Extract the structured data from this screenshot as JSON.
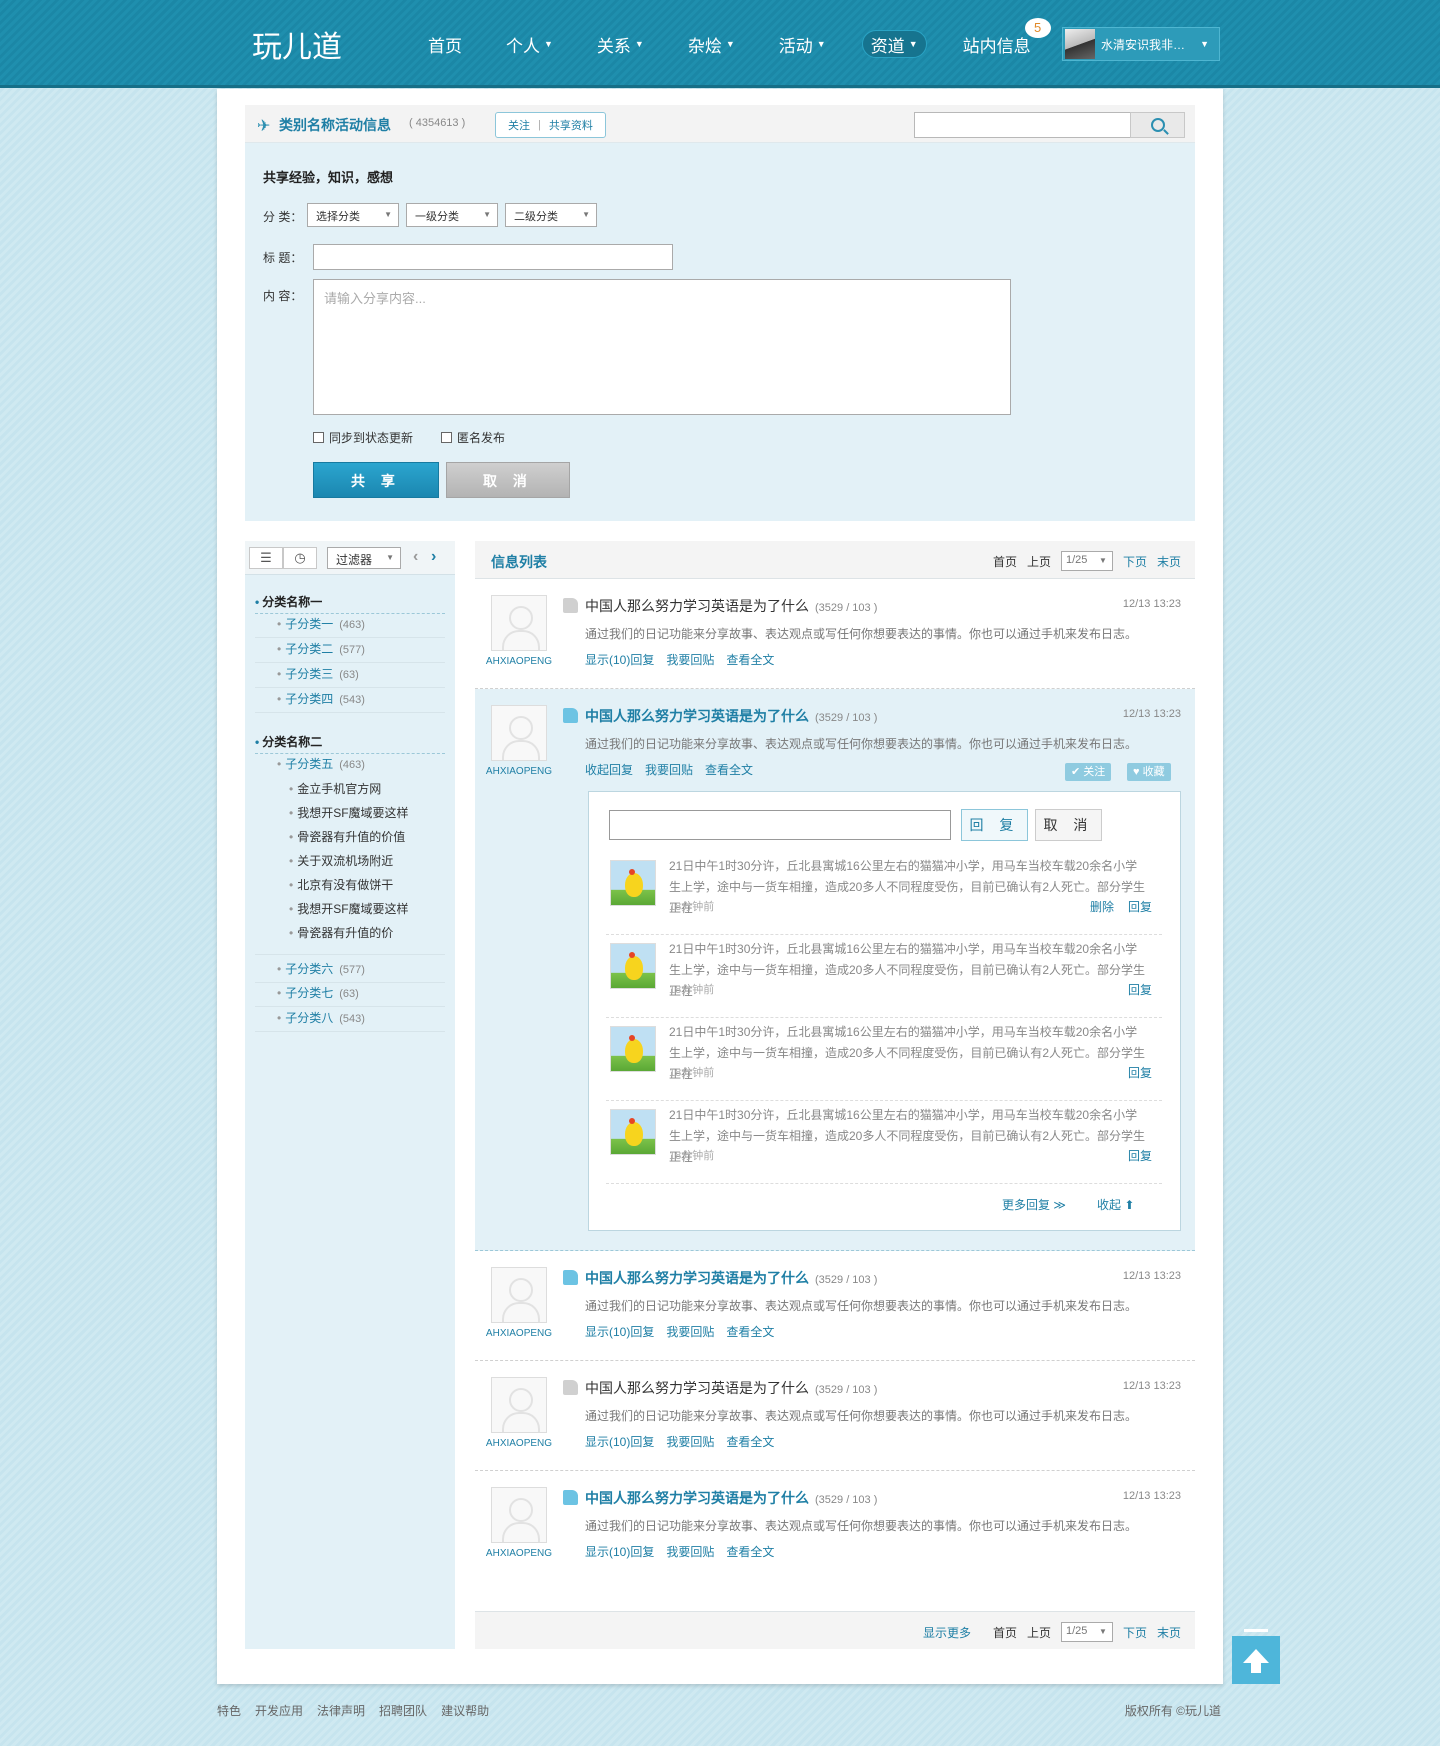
{
  "header": {
    "logo": "玩儿道",
    "nav": [
      {
        "label": "首页",
        "caret": false
      },
      {
        "label": "个人",
        "caret": true
      },
      {
        "label": "关系",
        "caret": true
      },
      {
        "label": "杂烩",
        "caret": true
      },
      {
        "label": "活动",
        "caret": true
      },
      {
        "label": "资道",
        "caret": true,
        "active": true
      },
      {
        "label": "站内信息",
        "caret": false,
        "badge": "5"
      }
    ],
    "user_name": "水清安识我非…"
  },
  "share": {
    "title": "类别名称活动信息",
    "count": "( 4354613 )",
    "tab_follow": "关注",
    "tab_profile": "共享资料",
    "search_placeholder": "",
    "subtitle": "共享经验，知识，感想",
    "label_category": "分 类：",
    "label_title": "标 题：",
    "label_content": "内 容：",
    "select_category": "选择分类",
    "select_level1": "一级分类",
    "select_level2": "二级分类",
    "content_placeholder": "请输入分享内容...",
    "sync_label": "同步到状态更新",
    "anon_label": "匿名发布",
    "share_btn": "共 享",
    "cancel_btn": "取 消"
  },
  "sidebar": {
    "filter_label": "过滤器",
    "cat1": "分类名称一",
    "cat2": "分类名称二",
    "subs": [
      {
        "name": "子分类一",
        "count": "(463)"
      },
      {
        "name": "子分类二",
        "count": "(577)"
      },
      {
        "name": "子分类三",
        "count": "(63)"
      },
      {
        "name": "子分类四",
        "count": "(543)"
      },
      {
        "name": "子分类五",
        "count": "(463)"
      },
      {
        "name": "子分类六",
        "count": "(577)"
      },
      {
        "name": "子分类七",
        "count": "(63)"
      },
      {
        "name": "子分类八",
        "count": "(543)"
      }
    ],
    "leaves": [
      "金立手机官方网",
      "我想开SF魔域要这样",
      "骨瓷器有升值的价值",
      "关于双流机场附近",
      "北京有没有做饼干",
      "我想开SF魔域要这样",
      "骨瓷器有升值的价"
    ]
  },
  "list": {
    "title": "信息列表",
    "first": "首页",
    "prev": "上页",
    "page": "1/25",
    "next": "下页",
    "last": "末页",
    "show_more": "显示更多"
  },
  "posts": [
    {
      "user": "AHXIAOPENG",
      "title": "中国人那么努力学习英语是为了什么",
      "count": "(3529 / 103 )",
      "time": "12/13 13:23",
      "desc": "通过我们的日记功能来分享故事、表达观点或写任何你想要表达的事情。你也可以通过手机来发布日志。",
      "a1": "显示(10)回复",
      "a2": "我要回贴",
      "a3": "查看全文"
    },
    {
      "user": "AHXIAOPENG",
      "title": "中国人那么努力学习英语是为了什么",
      "count": "(3529 / 103 )",
      "time": "12/13 13:23",
      "desc": "通过我们的日记功能来分享故事、表达观点或写任何你想要表达的事情。你也可以通过手机来发布日志。",
      "a1": "收起回复",
      "a2": "我要回贴",
      "a3": "查看全文",
      "follow": "关注",
      "collect": "收藏"
    },
    {
      "user": "AHXIAOPENG",
      "title": "中国人那么努力学习英语是为了什么",
      "count": "(3529 / 103 )",
      "time": "12/13 13:23",
      "desc": "通过我们的日记功能来分享故事、表达观点或写任何你想要表达的事情。你也可以通过手机来发布日志。",
      "a1": "显示(10)回复",
      "a2": "我要回贴",
      "a3": "查看全文"
    },
    {
      "user": "AHXIAOPENG",
      "title": "中国人那么努力学习英语是为了什么",
      "count": "(3529 / 103 )",
      "time": "12/13 13:23",
      "desc": "通过我们的日记功能来分享故事、表达观点或写任何你想要表达的事情。你也可以通过手机来发布日志。",
      "a1": "显示(10)回复",
      "a2": "我要回贴",
      "a3": "查看全文"
    },
    {
      "user": "AHXIAOPENG",
      "title": "中国人那么努力学习英语是为了什么",
      "count": "(3529 / 103 )",
      "time": "12/13 13:23",
      "desc": "通过我们的日记功能来分享故事、表达观点或写任何你想要表达的事情。你也可以通过手机来发布日志。",
      "a1": "显示(10)回复",
      "a2": "我要回贴",
      "a3": "查看全文"
    }
  ],
  "reply": {
    "reply_btn": "回 复",
    "cancel_btn": "取 消",
    "text": "21日中午1时30分许，丘北县寓城16公里左右的猫猫冲小学，用马车当校车载20余名小学生上学，途中与一货车相撞，造成20多人不同程度受伤，目前已确认有2人死亡。部分学生正在",
    "time": "18分钟前",
    "delete": "删除",
    "reply": "回复",
    "more": "更多回复 ≫",
    "collapse": "收起 ⬆"
  },
  "footer": {
    "links": [
      "特色",
      "开发应用",
      "法律声明",
      "招聘团队",
      "建议帮助"
    ],
    "copyright": "版权所有 ©玩儿道"
  }
}
